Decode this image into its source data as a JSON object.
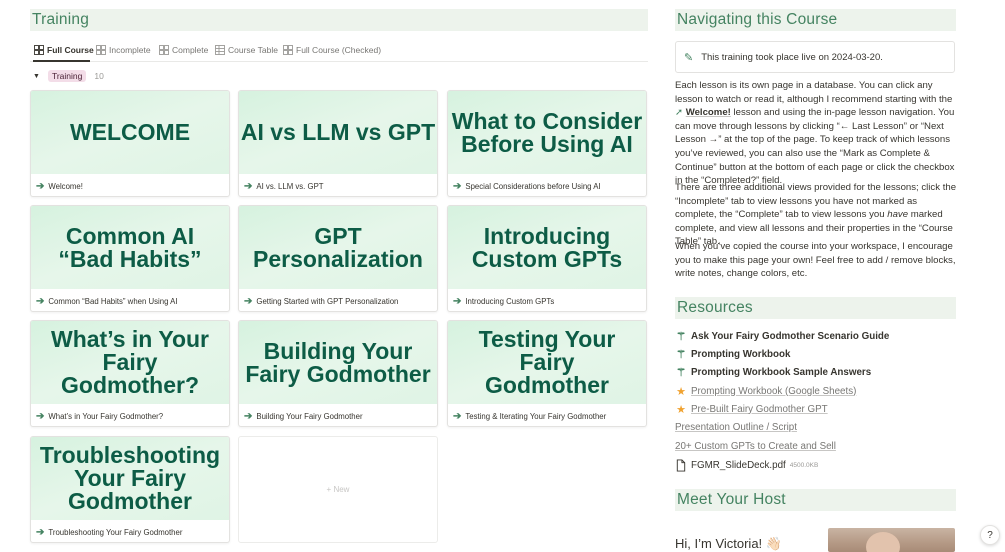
{
  "left": {
    "title": "Training",
    "tabs": [
      {
        "label": "Full Course",
        "active": true,
        "icon": "gallery-icon"
      },
      {
        "label": "Incomplete",
        "active": false,
        "icon": "gallery-icon"
      },
      {
        "label": "Complete",
        "active": false,
        "icon": "gallery-icon"
      },
      {
        "label": "Course Table",
        "active": false,
        "icon": "table-icon"
      },
      {
        "label": "Full Course (Checked)",
        "active": false,
        "icon": "gallery-icon"
      }
    ],
    "group": {
      "label": "Training",
      "count": "10"
    },
    "cards": [
      {
        "cover": "WELCOME",
        "caption": "Welcome!"
      },
      {
        "cover": "AI vs LLM vs GPT",
        "caption": "AI vs. LLM vs. GPT"
      },
      {
        "cover": "What to Consider\nBefore Using AI",
        "caption": "Special Considerations before Using AI"
      },
      {
        "cover": "Common AI\n“Bad Habits”",
        "caption": "Common “Bad Habits” when Using AI"
      },
      {
        "cover": "GPT\nPersonalization",
        "caption": "Getting Started with GPT Personalization"
      },
      {
        "cover": "Introducing\nCustom GPTs",
        "caption": "Introducing Custom GPTs"
      },
      {
        "cover": "What’s in Your\nFairy Godmother?",
        "caption": "What’s in Your Fairy Godmother?"
      },
      {
        "cover": "Building Your\nFairy Godmother",
        "caption": "Building Your Fairy Godmother"
      },
      {
        "cover": "Testing Your Fairy\nGodmother",
        "caption": "Testing & Iterating Your Fairy Godmother"
      },
      {
        "cover": "Troubleshooting\nYour Fairy\nGodmother",
        "caption": "Troubleshooting Your Fairy Godmother"
      }
    ],
    "new_label": "+ New"
  },
  "right": {
    "nav_title": "Navigating this Course",
    "callout": "This training took place live on 2024-03-20.",
    "para1": "Each lesson is its own page in a database. You can click any lesson to watch or read it, although I recommend starting with the",
    "para1_bold": "Welcome!",
    "para1_rest": " lesson and using the in-page lesson navigation. You can move through lessons by clicking “← Last Lesson” or “Next Lesson →” at the top of the page. To keep track of which lessons you’ve reviewed, you can also use the “Mark as Complete & Continue” button at the bottom of each page or click the checkbox in the “Completed?” field.",
    "para2a": "There are three additional views provided for the lessons; click the “Incomplete” tab to view lessons you have not marked as complete, the “Complete” tab to view lessons you ",
    "para2_em": "have",
    "para2b": " marked complete, and view all lessons and their properties in the “Course Table” tab.",
    "para3": "When you’ve copied the course into your workspace, I encourage you to make this page your own! Feel free to add / remove blocks, write notes, change colors, etc.",
    "resources_title": "Resources",
    "resources": [
      {
        "label": "Ask Your Fairy Godmother Scenario Guide",
        "icon": "magic-wand-icon",
        "style": "bold"
      },
      {
        "label": "Prompting Workbook",
        "icon": "magic-wand-icon",
        "style": "bold"
      },
      {
        "label": "Prompting Workbook Sample Answers",
        "icon": "magic-wand-icon",
        "style": "bold"
      },
      {
        "label": "Prompting Workbook (Google Sheets)",
        "icon": "star-icon",
        "style": "link"
      },
      {
        "label": "Pre-Built Fairy Godmother GPT",
        "icon": "star-icon",
        "style": "link"
      },
      {
        "label": "Presentation Outline / Script",
        "icon": "",
        "style": "link"
      },
      {
        "label": "20+ Custom GPTs to Create and Sell",
        "icon": "",
        "style": "link"
      }
    ],
    "file": {
      "name": "FGMR_SlideDeck.pdf",
      "size": "4500.0KB",
      "icon": "file-icon"
    },
    "host_title": "Meet Your Host",
    "greeting": "Hi, I’m Victoria! 👋🏻",
    "help": "?"
  },
  "colors": {
    "heading_bg": "#edf3ec",
    "heading_text": "#448361",
    "cover_text": "#0d5c46",
    "cover_bg": "#dff4e5",
    "pill_bg": "#f3dde8",
    "star": "#f0a230"
  }
}
